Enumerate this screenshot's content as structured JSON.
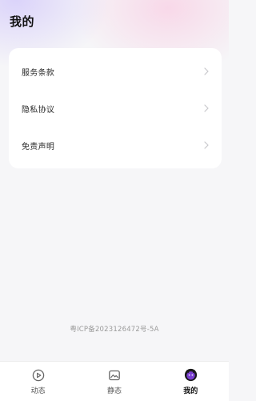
{
  "header": {
    "title": "我的"
  },
  "menu": {
    "items": [
      {
        "label": "服务条款",
        "icon": "chevron-right-icon"
      },
      {
        "label": "隐私协议",
        "icon": "chevron-right-icon"
      },
      {
        "label": "免责声明",
        "icon": "chevron-right-icon"
      }
    ]
  },
  "footer": {
    "icp": "粤ICP备2023126472号-5A"
  },
  "tabbar": {
    "tabs": [
      {
        "label": "动态",
        "icon": "play-circle-icon",
        "active": false
      },
      {
        "label": "静态",
        "icon": "image-icon",
        "active": false
      },
      {
        "label": "我的",
        "icon": "avatar-face-icon",
        "active": true
      }
    ]
  },
  "colors": {
    "background": "#f6f6f8",
    "card": "#ffffff",
    "gradient_purple": "#d6cdfa",
    "gradient_pink": "#f8d3e6",
    "active_icon_fill": "#7a3fd1"
  }
}
